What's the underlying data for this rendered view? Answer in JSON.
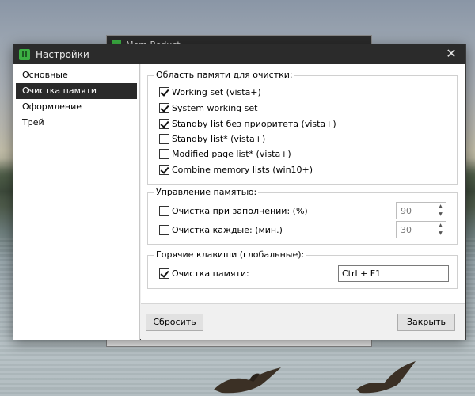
{
  "background_window": {
    "title": "Mem Reduct"
  },
  "window": {
    "title": "Настройки",
    "close_glyph": "✕"
  },
  "sidebar": {
    "items": [
      {
        "label": "Основные",
        "active": false
      },
      {
        "label": "Очистка памяти",
        "active": true
      },
      {
        "label": "Оформление",
        "active": false
      },
      {
        "label": "Трей",
        "active": false
      }
    ]
  },
  "memory_areas": {
    "title": "Область памяти для очистки:",
    "items": [
      {
        "label": "Working set (vista+)",
        "checked": true
      },
      {
        "label": "System working set",
        "checked": true
      },
      {
        "label": "Standby list без приоритета (vista+)",
        "checked": true
      },
      {
        "label": "Standby list* (vista+)",
        "checked": false
      },
      {
        "label": "Modified page list* (vista+)",
        "checked": false
      },
      {
        "label": "Combine memory lists (win10+)",
        "checked": true
      }
    ]
  },
  "memory_management": {
    "title": "Управление памятью:",
    "items": [
      {
        "label": "Очистка при заполнении: (%)",
        "checked": false,
        "value": "90"
      },
      {
        "label": "Очистка каждые: (мин.)",
        "checked": false,
        "value": "30"
      }
    ]
  },
  "hotkeys": {
    "title": "Горячие клавиши (глобальные):",
    "item": {
      "label": "Очистка памяти:",
      "checked": true,
      "value": "Ctrl + F1"
    }
  },
  "footer": {
    "reset_label": "Сбросить",
    "close_label": "Закрыть"
  },
  "colors": {
    "accent": "#3cb043",
    "titlebar": "#2b2b2b",
    "selected": "#2a2a2a"
  }
}
